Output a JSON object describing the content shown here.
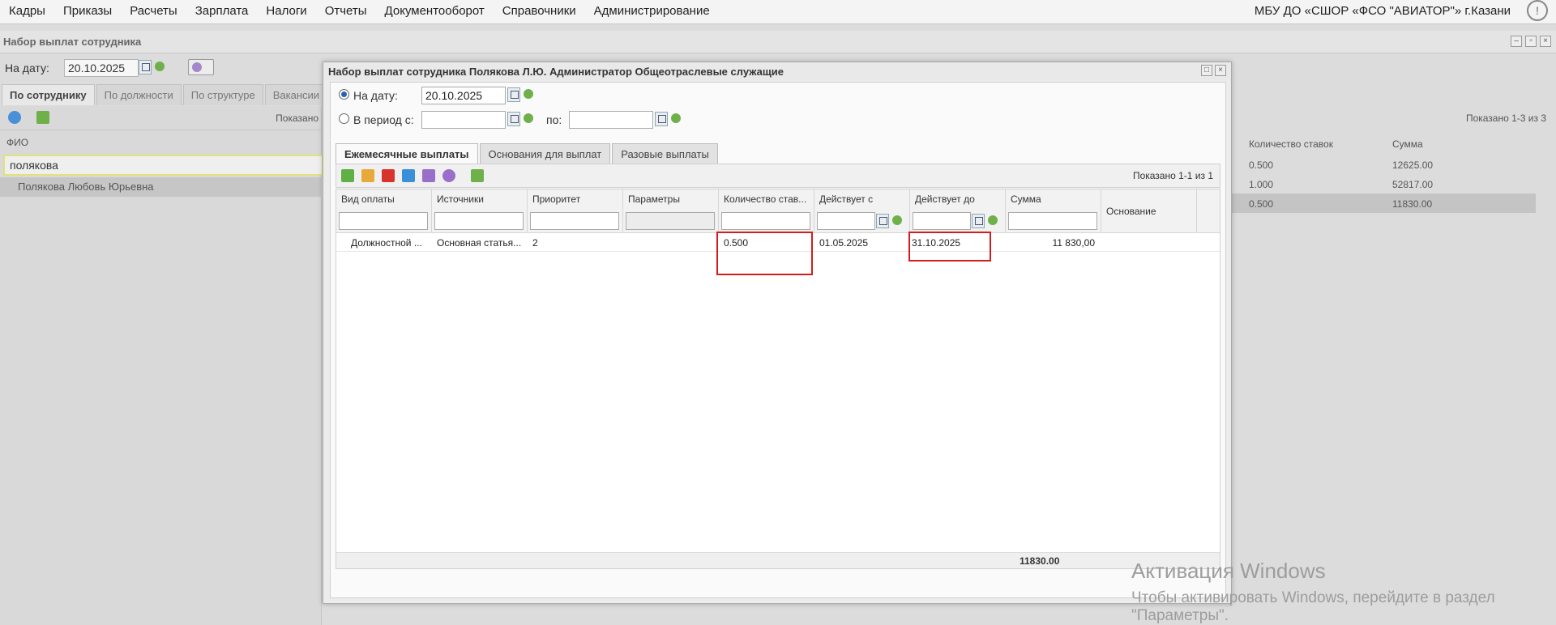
{
  "menu": [
    "Кадры",
    "Приказы",
    "Расчеты",
    "Зарплата",
    "Налоги",
    "Отчеты",
    "Документооборот",
    "Справочники",
    "Администрирование"
  ],
  "org_name": "МБУ ДО «СШОР «ФСО \"АВИАТОР\"» г.Казани",
  "bg": {
    "title": "Набор выплат сотрудника",
    "date_label": "На дату:",
    "date_value": "20.10.2025",
    "tabs": [
      "По сотруднику",
      "По должности",
      "По структуре",
      "Вакансии"
    ],
    "shown_left": "Показано",
    "fio_header": "ФИО",
    "search_value": "полякова",
    "employee": "Полякова Любовь Юрьевна",
    "shown_right": "Показано 1-3 из 3",
    "col_rate": "Количество ставок",
    "col_sum": "Сумма",
    "rows": [
      {
        "rate": "0.500",
        "sum": "12625.00"
      },
      {
        "rate": "1.000",
        "sum": "52817.00"
      },
      {
        "rate": "0.500",
        "sum": "11830.00"
      }
    ]
  },
  "modal": {
    "title": "Набор выплат сотрудника Полякова Л.Ю. Администратор Общеотраслевые служащие",
    "on_date_label": "На дату:",
    "on_date_value": "20.10.2025",
    "period_label": "В период с:",
    "period_to_label": "по:",
    "tabs": [
      "Ежемесячные выплаты",
      "Основания для выплат",
      "Разовые выплаты"
    ],
    "shown": "Показано 1-1 из 1",
    "columns": [
      "Вид оплаты",
      "Источники",
      "Приоритет",
      "Параметры",
      "Количество став...",
      "Действует с",
      "Действует до",
      "Сумма",
      "Основание"
    ],
    "row": {
      "pay_type": "Должностной ...",
      "source": "Основная статья...",
      "priority": "2",
      "params": "",
      "rate": "0.500",
      "from": "01.05.2025",
      "to": "31.10.2025",
      "sum": "11 830,00",
      "basis": ""
    },
    "total": "11830.00"
  },
  "watermark": {
    "line1": "Активация Windows",
    "line2": "Чтобы активировать Windows, перейдите в раздел \"Параметры\"."
  }
}
